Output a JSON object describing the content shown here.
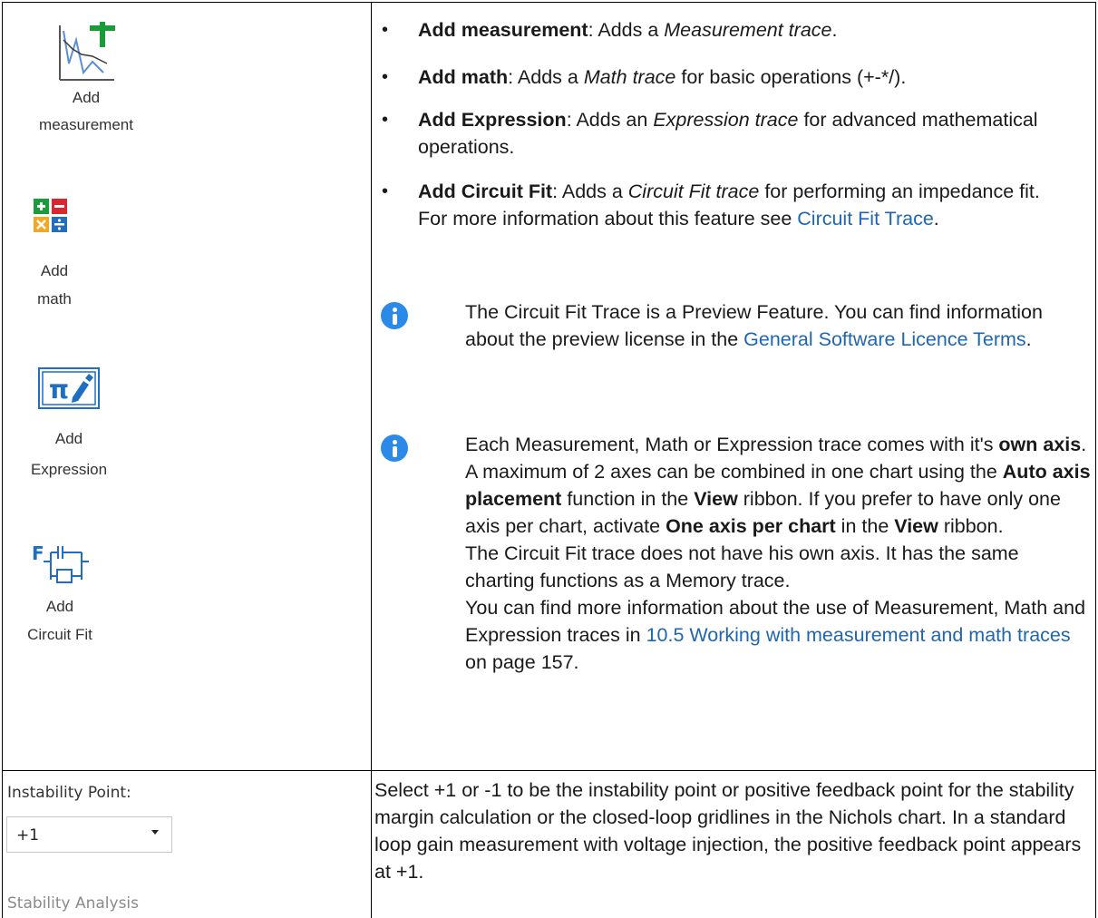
{
  "ribbon": {
    "add_measurement": [
      "Add",
      "measurement"
    ],
    "add_math": [
      "Add",
      "math"
    ],
    "add_expression": [
      "Add",
      "Expression"
    ],
    "add_circuit_fit": [
      "Add",
      "Circuit Fit"
    ],
    "instability_label": "Instability Point:",
    "instability_value": "+1",
    "group_label": "Stability Analysis"
  },
  "bullets": [
    {
      "bold": "Add measurement",
      "sep": ": Adds a ",
      "italic": "Measurement trace",
      "tail": "."
    },
    {
      "bold": "Add math",
      "sep": ": Adds a ",
      "italic": "Math trace",
      "tail": " for basic operations (+-*/)."
    },
    {
      "bold": "Add Expression",
      "sep": ": Adds an ",
      "italic": "Expression trace",
      "tail": " for advanced mathematical operations."
    },
    {
      "bold": "Add Circuit Fit",
      "sep": ": Adds a ",
      "italic": "Circuit Fit trace",
      "tail": " for performing an impedance fit. For more information about this feature see ",
      "link": "Circuit Fit Trace",
      "end": "."
    }
  ],
  "note1": {
    "text": "The Circuit Fit Trace is a Preview Feature. You can find information about the preview license in the ",
    "link": "General Software Licence Terms",
    "end": "."
  },
  "note2": {
    "t1": "Each Measurement, Math or Expression trace comes with it's ",
    "b1": "own axis",
    "t2": ". A maximum of 2 axes can be combined in one chart using the ",
    "b2": "Auto axis placement",
    "t3": " function in the ",
    "b3": "View",
    "t4": " ribbon. If you prefer to have only one axis per chart, activate ",
    "b4": "One axis per chart",
    "t5": " in the ",
    "b5": "View",
    "t6": " ribbon.",
    "p2": "The Circuit Fit trace does not have his own axis. It has the same charting functions as a Memory trace.",
    "p3": "You can find more information about the use of Measurement, Math and Expression traces in ",
    "link": "10.5 Working with measurement and math traces",
    "p3end": " on page 157."
  },
  "instability_desc": "Select +1 or -1 to be the instability point or positive feedback point for the stability margin calculation or the closed-loop gridlines in the Nichols chart. In a standard loop gain measurement with voltage injection, the positive feedback point appears at +1.",
  "colors": {
    "link": "#1f66b0",
    "info": "#2b8ae8",
    "green": "#1a9c3a",
    "red": "#d9272e",
    "orange": "#f5a623",
    "blue": "#1e6fc2"
  }
}
